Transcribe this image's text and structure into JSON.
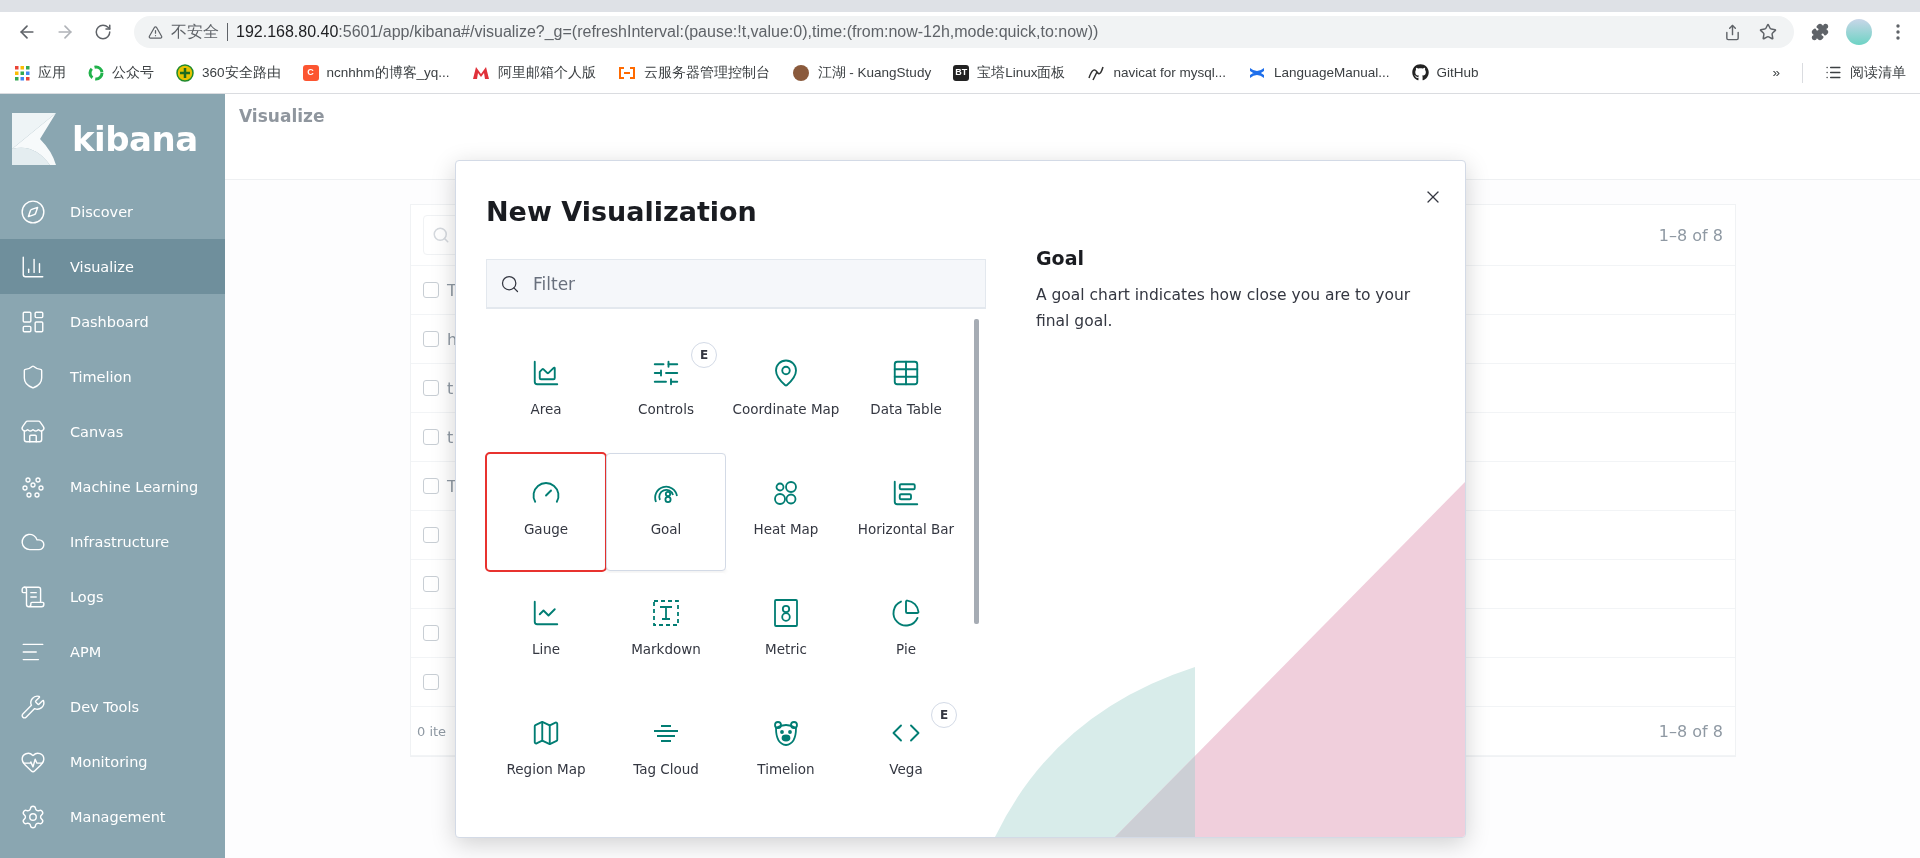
{
  "browser": {
    "security_label": "不安全",
    "url_host": "192.168.80.40",
    "url_rest": ":5601/app/kibana#/visualize?_g=(refreshInterval:(pause:!t,value:0),time:(from:now-12h,mode:quick,to:now))",
    "bookmarks": [
      {
        "label": "应用"
      },
      {
        "label": "公众号"
      },
      {
        "label": "360安全路由"
      },
      {
        "label": "ncnhhm的博客_yq...",
        "icon_text": "C"
      },
      {
        "label": "阿里邮箱个人版"
      },
      {
        "label": "云服务器管理控制台"
      },
      {
        "label": "江湖 - KuangStudy"
      },
      {
        "label": "宝塔Linux面板",
        "icon_text": "BT"
      },
      {
        "label": "navicat for mysql..."
      },
      {
        "label": "LanguageManual..."
      },
      {
        "label": "GitHub"
      }
    ],
    "more": "»",
    "reading_list": "阅读清单"
  },
  "sidebar": {
    "logo": "kibana",
    "items": [
      {
        "label": "Discover",
        "selected": false
      },
      {
        "label": "Visualize",
        "selected": true
      },
      {
        "label": "Dashboard",
        "selected": false
      },
      {
        "label": "Timelion",
        "selected": false
      },
      {
        "label": "Canvas",
        "selected": false
      },
      {
        "label": "Machine Learning",
        "selected": false
      },
      {
        "label": "Infrastructure",
        "selected": false
      },
      {
        "label": "Logs",
        "selected": false
      },
      {
        "label": "APM",
        "selected": false
      },
      {
        "label": "Dev Tools",
        "selected": false
      },
      {
        "label": "Monitoring",
        "selected": false
      },
      {
        "label": "Management",
        "selected": false
      }
    ]
  },
  "page": {
    "title": "Visualize",
    "table": {
      "count_top": "1–8 of 8",
      "rows": [
        {
          "text": "T",
          "checked": false
        },
        {
          "text": "h",
          "checked": false
        },
        {
          "text": "t",
          "checked": false
        },
        {
          "text": "t",
          "checked": false
        },
        {
          "text": "T",
          "checked": false
        },
        {
          "checked": false
        },
        {
          "checked": false
        },
        {
          "checked": false
        },
        {
          "checked": false
        }
      ],
      "footer": "0 ite",
      "count_bottom": "1–8 of 8"
    }
  },
  "dialog": {
    "title": "New Visualization",
    "filter": {
      "placeholder": "Filter"
    },
    "types": [
      {
        "label": "Area",
        "selected": false,
        "annotated": false
      },
      {
        "label": "Controls",
        "selected": false,
        "annotated": false,
        "badge": "E"
      },
      {
        "label": "Coordinate Map",
        "selected": false,
        "annotated": false
      },
      {
        "label": "Data Table",
        "selected": false,
        "annotated": false
      },
      {
        "label": "Gauge",
        "selected": false,
        "annotated": true
      },
      {
        "label": "Goal",
        "selected": true,
        "annotated": false
      },
      {
        "label": "Heat Map",
        "selected": false,
        "annotated": false
      },
      {
        "label": "Horizontal Bar",
        "selected": false,
        "annotated": false
      },
      {
        "label": "Line",
        "selected": false,
        "annotated": false
      },
      {
        "label": "Markdown",
        "selected": false,
        "annotated": false
      },
      {
        "label": "Metric",
        "selected": false,
        "annotated": false
      },
      {
        "label": "Pie",
        "selected": false,
        "annotated": false
      },
      {
        "label": "Region Map",
        "selected": false,
        "annotated": false
      },
      {
        "label": "Tag Cloud",
        "selected": false,
        "annotated": false
      },
      {
        "label": "Timelion",
        "selected": false,
        "annotated": false
      },
      {
        "label": "Vega",
        "selected": false,
        "annotated": false,
        "badge": "E"
      }
    ],
    "detail": {
      "title": "Goal",
      "description": "A goal chart indicates how close you are to your final goal."
    }
  }
}
